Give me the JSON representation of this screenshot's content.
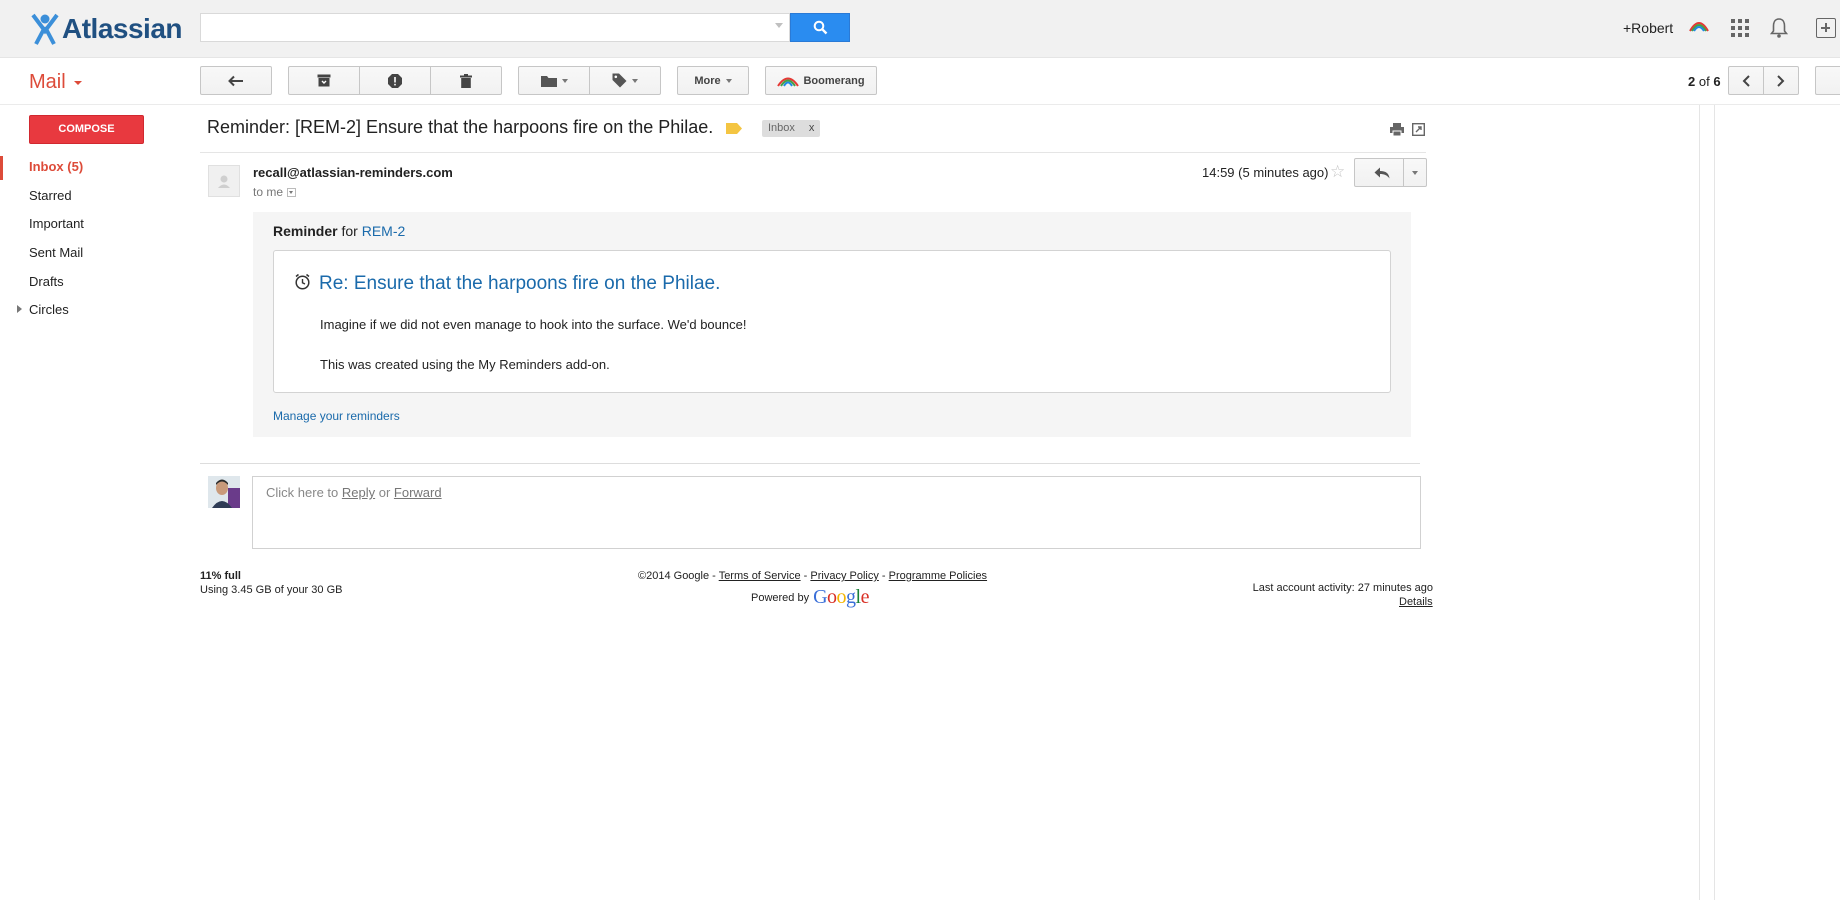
{
  "header": {
    "logo_text": "Atlassian",
    "search_placeholder": "",
    "user_name": "+Robert"
  },
  "toolbar": {
    "mail_label": "Mail",
    "more_label": "More",
    "boomerang_label": "Boomerang",
    "page_current": "2",
    "page_of": "of",
    "page_total": "6"
  },
  "sidebar": {
    "compose_label": "COMPOSE",
    "items": [
      {
        "label": "Inbox (5)",
        "active": true
      },
      {
        "label": "Starred"
      },
      {
        "label": "Important"
      },
      {
        "label": "Sent Mail"
      },
      {
        "label": "Drafts"
      },
      {
        "label": "Circles"
      }
    ]
  },
  "message": {
    "subject": "Reminder: [REM-2] Ensure that the harpoons fire on the Philae.",
    "label_chip": "Inbox",
    "label_chip_close": "x",
    "sender": "recall@atlassian-reminders.com",
    "to": "to me",
    "timestamp": "14:59 (5 minutes ago)",
    "reminder": {
      "head_bold": "Reminder",
      "head_for": " for ",
      "head_link": "REM-2",
      "title": "Re: Ensure that the harpoons fire on the Philae.",
      "body1": "Imagine if we did not even manage to hook into the surface. We'd bounce!",
      "body2": "This was created using the My Reminders add-on.",
      "manage_link": "Manage your reminders"
    },
    "reply_prompt": {
      "prefix": "Click here to ",
      "reply": "Reply",
      "or": " or ",
      "forward": "Forward"
    }
  },
  "footer": {
    "quota_line1": "11% full",
    "quota_line2": "Using 3.45 GB of your 30 GB",
    "copyright": "©2014 Google - ",
    "terms": "Terms of Service",
    "dash1": " - ",
    "privacy": "Privacy Policy",
    "dash2": " - ",
    "programme": "Programme Policies",
    "powered_by": "Powered by",
    "google_word": "Google",
    "activity": "Last account activity: 27 minutes ago",
    "details": "Details"
  },
  "colors": {
    "accent_red": "#dd4b39",
    "compose_red": "#e8393f",
    "search_blue": "#2a8cf0",
    "link_blue": "#1a6aab",
    "atlassian_blue": "#205081"
  },
  "icons": [
    "atlassian-logo-icon",
    "search-icon",
    "boomerang-icon",
    "apps-grid-icon",
    "bell-icon",
    "add-box-icon",
    "back-arrow-icon",
    "archive-icon",
    "spam-icon",
    "trash-icon",
    "folder-icon",
    "tag-icon",
    "chevron-left-icon",
    "chevron-right-icon",
    "label-tag-icon",
    "print-icon",
    "new-window-icon",
    "star-icon",
    "reply-icon",
    "clock-icon"
  ]
}
